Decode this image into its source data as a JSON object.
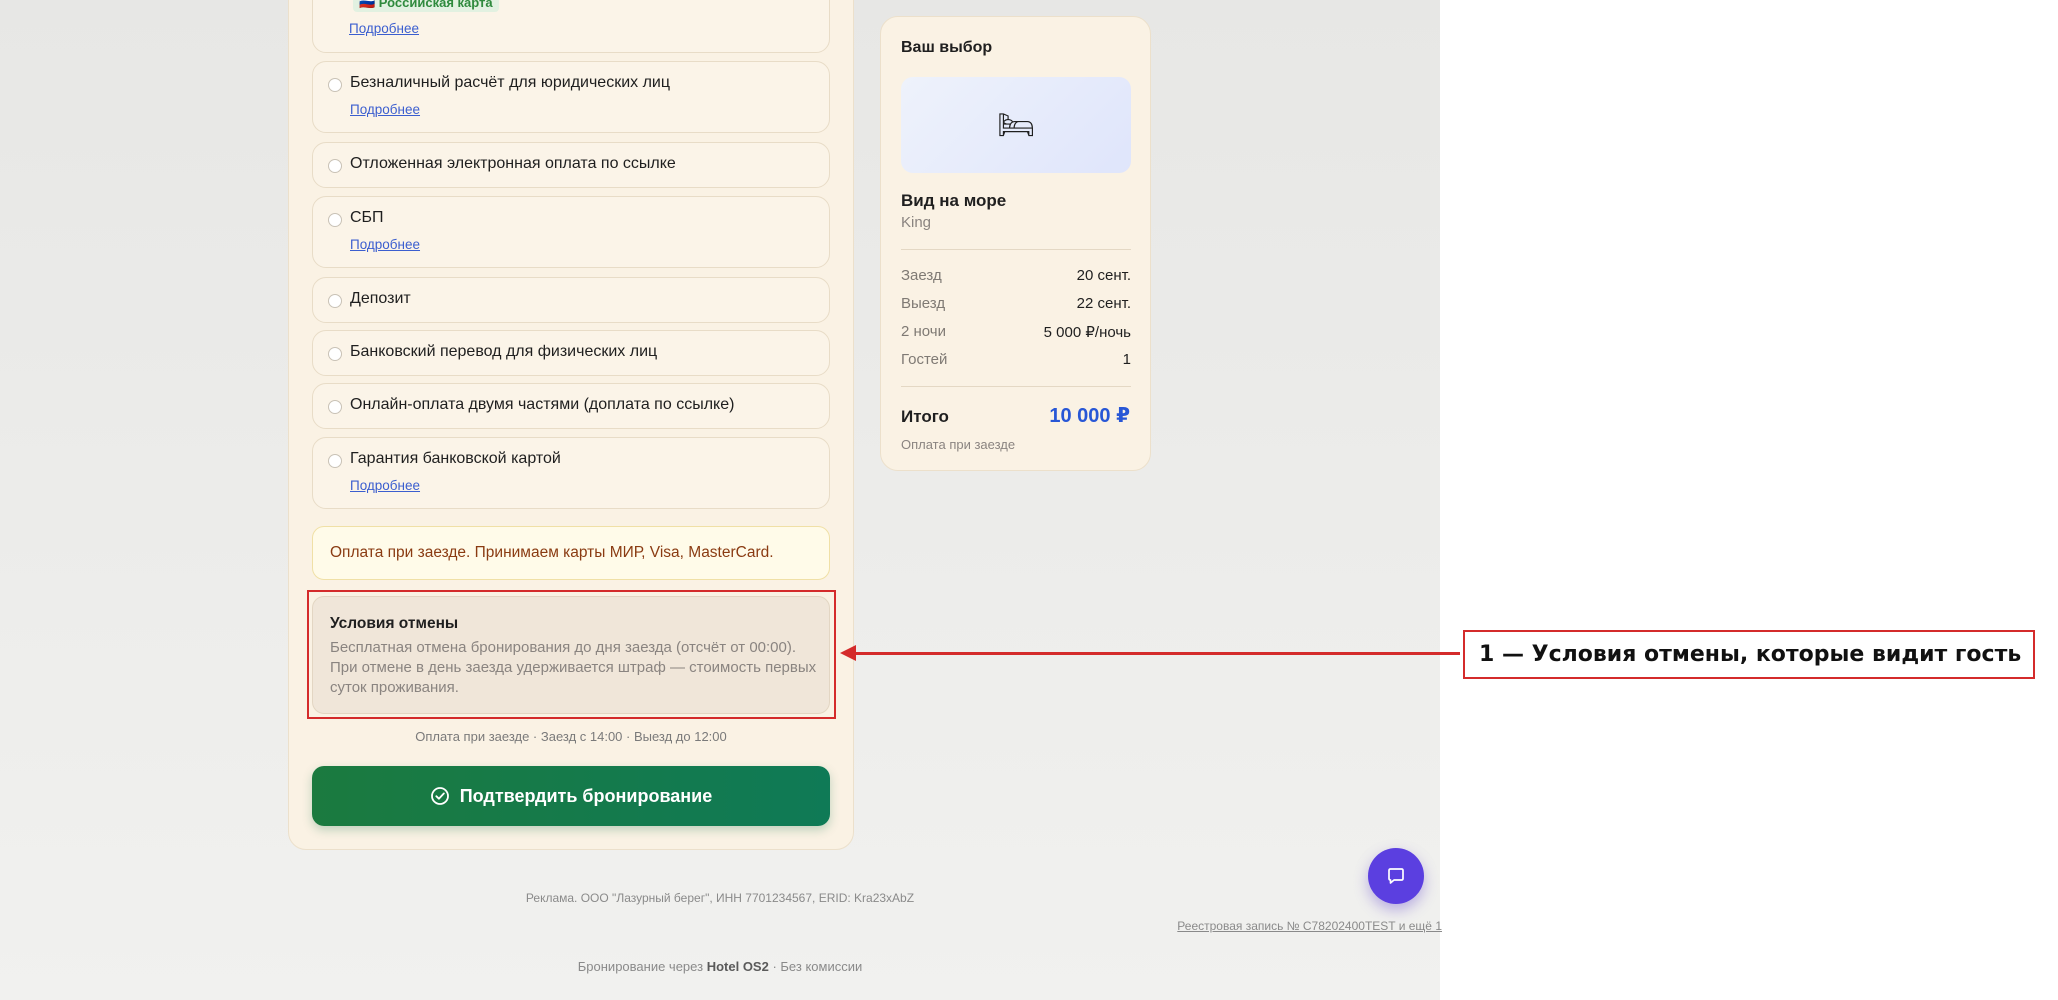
{
  "payment_options": [
    {
      "id": "card",
      "badge": "🇷🇺 Российская карта",
      "link": "Подробнее"
    },
    {
      "id": "cashless",
      "label": "Безналичный расчёт для юридических лиц",
      "link": "Подробнее"
    },
    {
      "id": "deferred",
      "label": "Отложенная электронная оплата по ссылке"
    },
    {
      "id": "sbp",
      "label": "СБП",
      "link": "Подробнее"
    },
    {
      "id": "deposit",
      "label": "Депозит"
    },
    {
      "id": "bank-transfer",
      "label": "Банковский перевод для физических лиц"
    },
    {
      "id": "two-parts",
      "label": "Онлайн-оплата двумя частями (доплата по ссылке)"
    },
    {
      "id": "guarantee",
      "label": "Гарантия банковской картой",
      "link": "Подробнее"
    }
  ],
  "payment_note": "Оплата при заезде. Принимаем карты МИР, Visa, MasterCard.",
  "cancellation": {
    "title": "Условия отмены",
    "text": "Бесплатная отмена бронирования до дня заезда (отсчёт от 00:00). При отмене в день заезда удерживается штраф — стоимость первых суток проживания."
  },
  "info_line": "Оплата при заезде · Заезд с 14:00 · Выезд до 12:00",
  "confirm_label": "Подтвердить бронирование",
  "summary": {
    "title": "Ваш выбор",
    "room_icon": "🛏",
    "room_name": "Вид на море",
    "bed": "King",
    "rows": [
      {
        "k": "Заезд",
        "v": "20 сент."
      },
      {
        "k": "Выезд",
        "v": "22 сент."
      },
      {
        "k": "2 ночи",
        "v": "5 000 ₽/ночь"
      },
      {
        "k": "Гостей",
        "v": "1"
      }
    ],
    "total_label": "Итого",
    "total_value": "10 000 ₽",
    "total_note": "Оплата при заезде"
  },
  "footer": {
    "ad": "Реклама. ООО \"Лазурный берег\", ИНН 7701234567, ERID: Kra23xAbZ",
    "registry": "Реестровая запись № С78202400TEST и ещё 1",
    "powered_prefix": "Бронирование через",
    "powered_brand": "Hotel OS2",
    "powered_suffix": "· Без комиссии"
  },
  "annotation": {
    "label": "1 — Условия отмены, которые видит гость",
    "color": "#d42b2b"
  },
  "colors": {
    "accent_green": "#1b7a3f",
    "total_blue": "#2857d6",
    "chat_purple": "#5b3fe0",
    "link_blue": "#3b5ecf"
  }
}
